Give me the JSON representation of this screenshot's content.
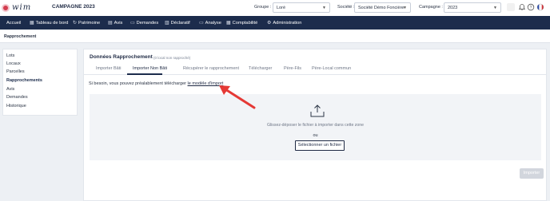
{
  "header": {
    "logo_text": "wim",
    "campaign_title": "CAMPAGNE 2023",
    "groupe": {
      "label": "Groupe :",
      "value": "Loré"
    },
    "societe": {
      "label": "Société :",
      "value": "Société Démo Foncière"
    },
    "campagne": {
      "label": "Campagne :",
      "value": "2023"
    }
  },
  "nav": {
    "items": [
      {
        "label": "Accueil",
        "icon": ""
      },
      {
        "label": "Tableau de bord",
        "icon": "grid-icon"
      },
      {
        "label": "Patrimoine",
        "icon": "refresh-icon"
      },
      {
        "label": "Avis",
        "icon": "document-icon"
      },
      {
        "label": "Demandes",
        "icon": "inbox-icon"
      },
      {
        "label": "Déclaratif",
        "icon": "ledger-icon"
      },
      {
        "label": "Analyse",
        "icon": "folder-icon"
      },
      {
        "label": "Comptabilité",
        "icon": "calculator-icon"
      },
      {
        "label": "Administration",
        "icon": "gear-icon"
      }
    ]
  },
  "breadcrumb": "Rapprochement",
  "sidebar": {
    "items": [
      "Lots",
      "Locaux",
      "Parcelles",
      "Rapprochements",
      "Avis",
      "Demandes",
      "Historique"
    ],
    "active": "Rapprochements"
  },
  "card": {
    "title": "Données Rapprochement",
    "subtitle": "(0 local non rapproché)",
    "tabs": [
      "Importer Bâti",
      "Importer Non Bâti",
      "Récupérer le rapprochement",
      "Télécharger",
      "Père-Fils",
      "Père-Local commun"
    ],
    "active_tab": "Importer Non Bâti",
    "help_prefix": "Si besoin, vous pouvez préalablement télécharger ",
    "help_link": "le modèle d'import",
    "drop_text": "Glissez-déposer le fichier à importer dans cette zone",
    "drop_or": "ou",
    "select_file_button": "Sélectionner un fichier",
    "import_button": "Importer"
  },
  "colors": {
    "nav_bg": "#1c2c4c",
    "accent_red": "#e53935",
    "page_bg": "#edf0f4"
  }
}
